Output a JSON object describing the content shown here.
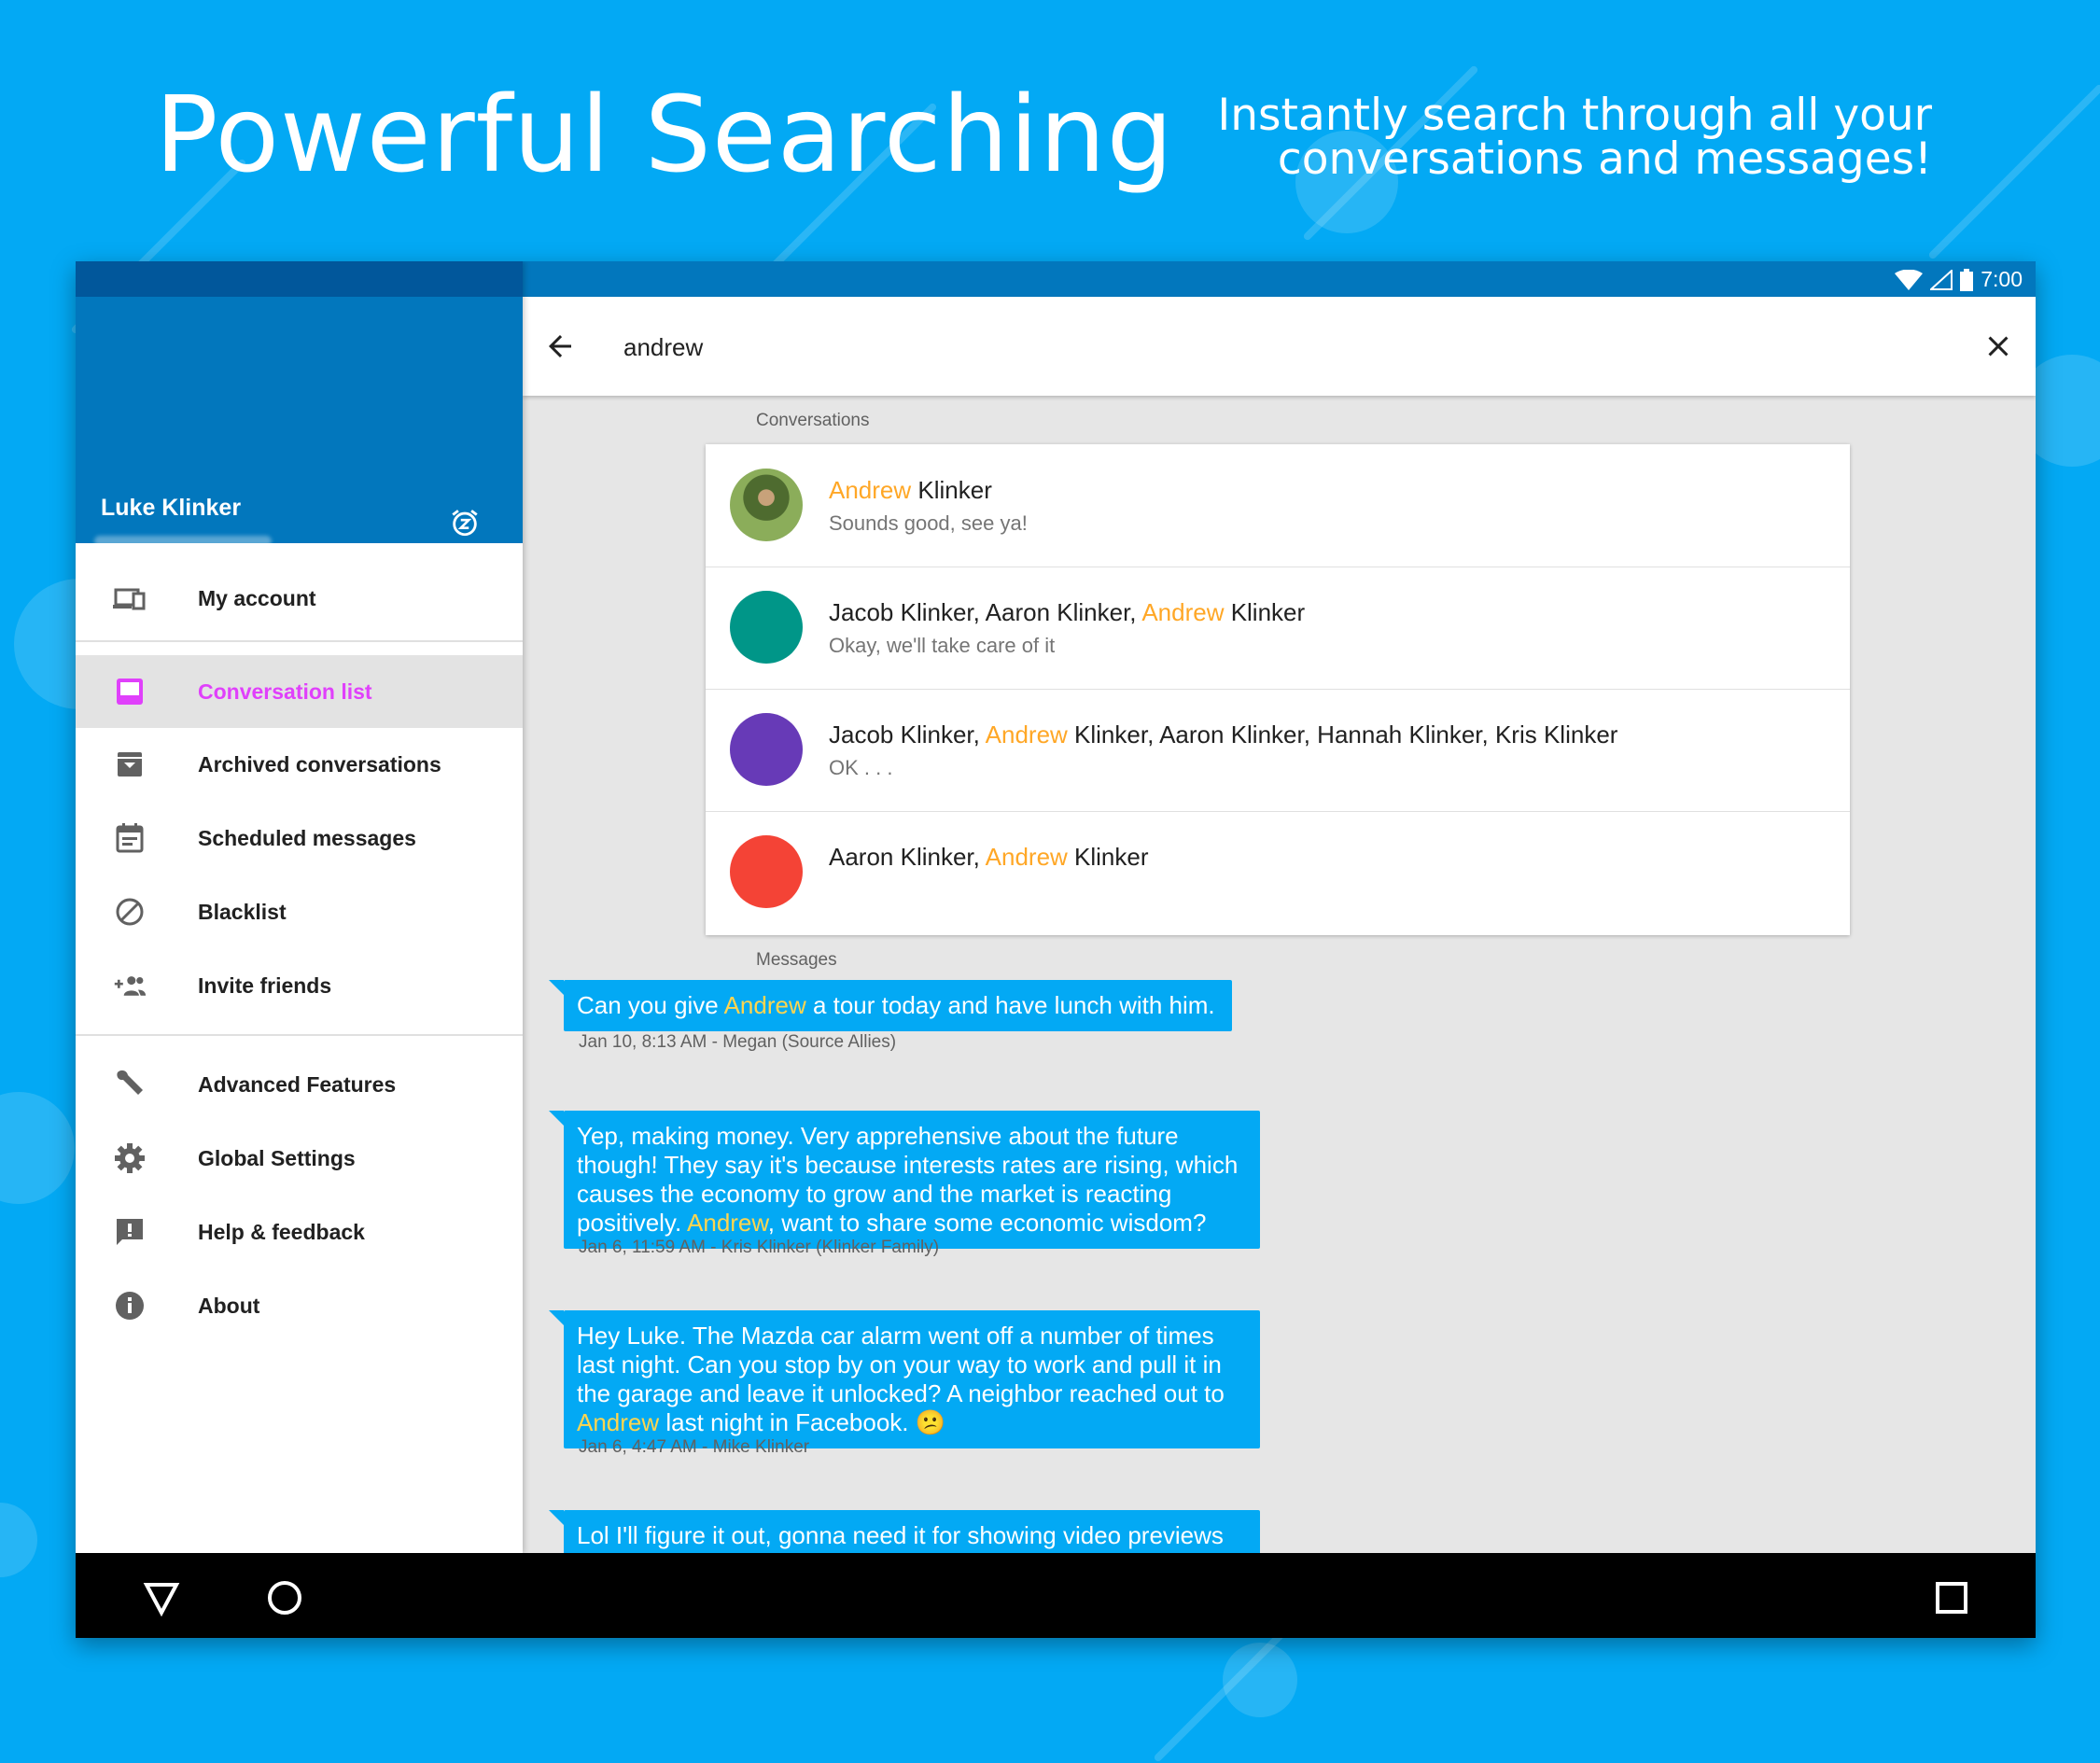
{
  "banner": {
    "headline": "Powerful Searching",
    "tagline_line1": "Instantly search through all your",
    "tagline_line2": "conversations and messages!"
  },
  "status_bar": {
    "time": "7:00"
  },
  "drawer": {
    "user_name": "Luke Klinker",
    "items": [
      {
        "label": "My account",
        "icon": "devices-icon"
      },
      {
        "label": "Conversation list",
        "icon": "inbox-icon",
        "active": true
      },
      {
        "label": "Archived conversations",
        "icon": "archive-icon"
      },
      {
        "label": "Scheduled messages",
        "icon": "calendar-icon"
      },
      {
        "label": "Blacklist",
        "icon": "block-icon"
      },
      {
        "label": "Invite friends",
        "icon": "group-add-icon"
      },
      {
        "label": "Advanced Features",
        "icon": "wrench-icon"
      },
      {
        "label": "Global Settings",
        "icon": "gear-icon"
      },
      {
        "label": "Help & feedback",
        "icon": "feedback-icon"
      },
      {
        "label": "About",
        "icon": "info-icon"
      }
    ]
  },
  "search": {
    "query": "andrew"
  },
  "results": {
    "conversations_label": "Conversations",
    "messages_label": "Messages",
    "conversations": [
      {
        "before": "",
        "match": "Andrew",
        "after": " Klinker",
        "snippet": "Sounds good, see ya!",
        "avatar": "photo",
        "color": "#7cb342"
      },
      {
        "before": "Jacob Klinker, Aaron Klinker, ",
        "match": "Andrew",
        "after": " Klinker",
        "snippet": "Okay, we'll take care of it",
        "avatar": "circle",
        "color": "#009688"
      },
      {
        "before": "Jacob Klinker, ",
        "match": "Andrew",
        "after": " Klinker, Aaron Klinker, Hannah Klinker, Kris Klinker",
        "snippet": "OK . . .",
        "avatar": "circle",
        "color": "#673ab7"
      },
      {
        "before": "Aaron Klinker, ",
        "match": "Andrew",
        "after": " Klinker",
        "snippet": "",
        "avatar": "circle",
        "color": "#f44336"
      }
    ],
    "messages": [
      {
        "before": "Can you give ",
        "match": "Andrew",
        "after": " a tour today and have lunch with him.",
        "meta": "Jan 10, 8:13 AM - Megan (Source Allies)"
      },
      {
        "before": "Yep, making money.  Very apprehensive about the future though! They say it's because interests rates are rising, which causes the economy to grow and the market is reacting positively.  ",
        "match": "Andrew",
        "after": ", want to share some economic wisdom?",
        "meta": "Jan 6, 11:59 AM - Kris Klinker (Klinker Family)"
      },
      {
        "before": "Hey Luke. The Mazda car alarm went off a number of times last night. Can you stop by on your way to work and pull it in the garage and leave it unlocked? A neighbor reached out to ",
        "match": "Andrew",
        "after": " last night in Facebook. 😕",
        "meta": "Jan 6, 4:47 AM - Mike Klinker"
      },
      {
        "before": "Lol I'll figure it out, gonna need it for showing video previews",
        "match": "",
        "after": "",
        "meta": ""
      }
    ]
  },
  "colors": {
    "accent": "#03a9f4",
    "primary_dark": "#0277bd",
    "highlight": "#ffa726",
    "active_nav": "#e040fb"
  }
}
